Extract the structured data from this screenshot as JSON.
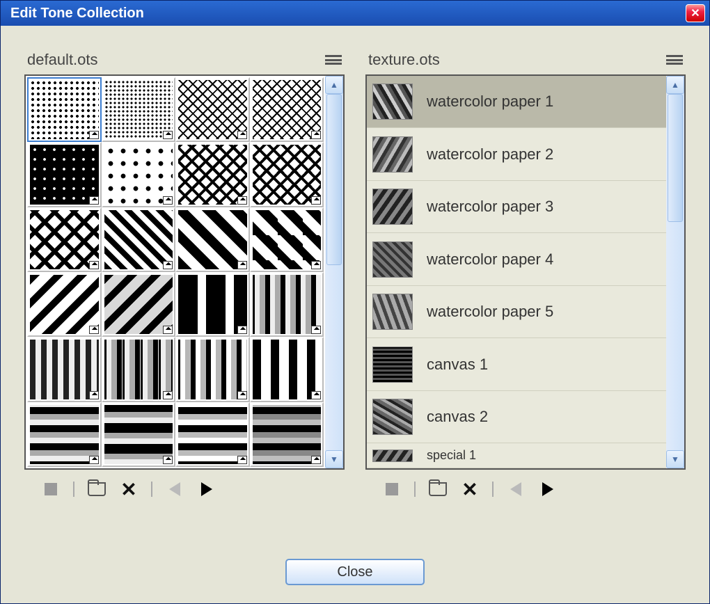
{
  "titlebar": {
    "title": "Edit Tone Collection"
  },
  "left": {
    "title": "default.ots"
  },
  "right": {
    "title": "texture.ots",
    "items": [
      {
        "label": "watercolor paper 1"
      },
      {
        "label": "watercolor paper 2"
      },
      {
        "label": "watercolor paper 3"
      },
      {
        "label": "watercolor paper 4"
      },
      {
        "label": "watercolor paper 5"
      },
      {
        "label": "canvas 1"
      },
      {
        "label": "canvas 2"
      },
      {
        "label": "special 1"
      }
    ]
  },
  "footer": {
    "close_label": "Close"
  }
}
